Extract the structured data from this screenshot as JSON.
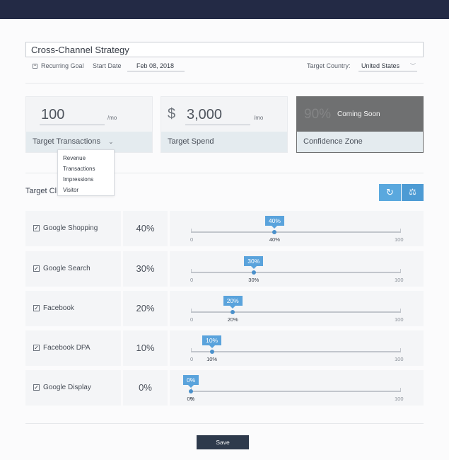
{
  "strategy": {
    "name": "Cross-Channel Strategy",
    "recurring_label": "Recurring Goal",
    "recurring_checked": false,
    "start_date_label": "Start Date",
    "start_date_value": "Feb 08, 2018",
    "country_label": "Target Country:",
    "country_value": "United States"
  },
  "cards": {
    "transactions": {
      "value": "100",
      "unit": "/mo",
      "label": "Target Transactions"
    },
    "spend": {
      "currency": "$",
      "value": "3,000",
      "unit": "/mo",
      "label": "Target Spend"
    },
    "confidence": {
      "value": "90%",
      "overlay": "Coming Soon",
      "label": "Confidence Zone"
    }
  },
  "dropdown": {
    "items": [
      "Revenue",
      "Transactions",
      "Impressions",
      "Visitor"
    ]
  },
  "section": {
    "title_visible": "Target Cl"
  },
  "slider_scale": {
    "min": "0",
    "max": "100"
  },
  "channels": [
    {
      "name": "Google Shopping",
      "checked": true,
      "share": "40%",
      "value": 40
    },
    {
      "name": "Google Search",
      "checked": true,
      "share": "30%",
      "value": 30
    },
    {
      "name": "Facebook",
      "checked": true,
      "share": "20%",
      "value": 20
    },
    {
      "name": "Facebook DPA",
      "checked": true,
      "share": "10%",
      "value": 10
    },
    {
      "name": "Google Display",
      "checked": true,
      "share": "0%",
      "value": 0
    }
  ],
  "actions": {
    "save_label": "Save"
  },
  "colors": {
    "topbar": "#232a45",
    "accent": "#5aa3dc",
    "save": "#2e3a4c",
    "dark_card": "#6f7071"
  }
}
